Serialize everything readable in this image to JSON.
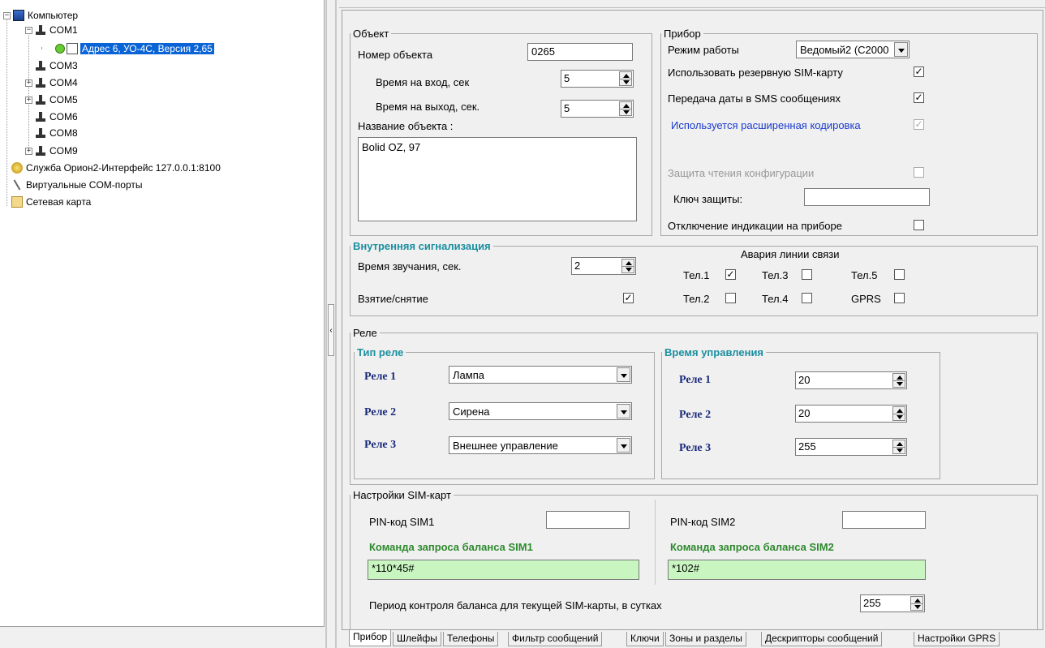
{
  "tree": {
    "root": "Компьютер",
    "com1": "COM1",
    "device": "Адрес 6, УО-4С, Версия 2,65",
    "com3": "COM3",
    "com4": "COM4",
    "com5": "COM5",
    "com6": "COM6",
    "com8": "COM8",
    "com9": "COM9",
    "service": "Служба Орион2-Интерфейс 127.0.0.1:8100",
    "virtual": "Виртуальные COM-порты",
    "netmap": "Сетевая карта"
  },
  "object": {
    "legend": "Объект",
    "number_label": "Номер объекта",
    "number_value": "0265",
    "entry_label": "Время на вход, сек",
    "entry_value": "5",
    "exit_label": "Время на выход, сек.",
    "exit_value": "5",
    "name_label": "Название объекта :",
    "name_value": "Bolid OZ, 97"
  },
  "device": {
    "legend": "Прибор",
    "mode_label": "Режим работы",
    "mode_value": "Ведомый2 (С2000",
    "reserve_sim_label": "Использовать резервную SIM-карту",
    "reserve_sim_checked": true,
    "sms_date_label": "Передача даты в SMS сообщениях",
    "sms_date_checked": true,
    "ext_encoding_label": "Используется расширенная кодировка",
    "ext_encoding_checked": true,
    "read_protect_label": "Защита чтения конфигурации",
    "key_label": "Ключ защиты:",
    "key_value": "",
    "disable_indication_label": "Отключение индикации на приборе"
  },
  "internal": {
    "legend": "Внутренняя сигнализация",
    "sound_time_label": "Время звучания, сек.",
    "sound_time_value": "2",
    "arm_label": "Взятие/снятие",
    "arm_checked": true,
    "alarm_title": "Авария линии связи",
    "tel1": "Тел.1",
    "tel2": "Тел.2",
    "tel3": "Тел.3",
    "tel4": "Тел.4",
    "tel5": "Тел.5",
    "gprs": "GPRS",
    "tel1_checked": true
  },
  "relay": {
    "legend": "Реле",
    "type_legend": "Тип реле",
    "time_legend": "Время управления",
    "r1": "Реле 1",
    "r2": "Реле 2",
    "r3": "Реле 3",
    "r1_type": "Лампа",
    "r2_type": "Сирена",
    "r3_type": "Внешнее управление",
    "r1_time": "20",
    "r2_time": "20",
    "r3_time": "255"
  },
  "sim": {
    "legend": "Настройки SIM-карт",
    "pin1_label": "PIN-код SIM1",
    "pin2_label": "PIN-код SIM2",
    "pin1_value": "",
    "pin2_value": "",
    "bal1_label": "Команда запроса баланса SIM1",
    "bal2_label": "Команда запроса баланса SIM2",
    "bal1_value": "*110*45#",
    "bal2_value": "*102#",
    "period_label": "Период контроля баланса для текущей SIM-карты, в сутках",
    "period_value": "255"
  },
  "tabs": [
    "Прибор",
    "Шлейфы",
    "Телефоны",
    "Фильтр сообщений",
    "Ключи",
    "Зоны и разделы",
    "Дескрипторы сообщений",
    "Настройки GPRS"
  ],
  "check_mark": "✓"
}
